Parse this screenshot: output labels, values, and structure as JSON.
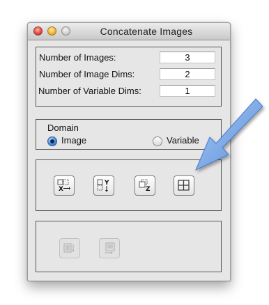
{
  "window": {
    "title": "Concatenate Images"
  },
  "dimensions": {
    "rows": [
      {
        "label": "Number of Images:",
        "value": "3"
      },
      {
        "label": "Number of Image Dims:",
        "value": "2"
      },
      {
        "label": "Number of Variable Dims:",
        "value": "1"
      }
    ]
  },
  "domain": {
    "label": "Domain",
    "options": [
      {
        "label": "Image",
        "selected": true
      },
      {
        "label": "Variable",
        "selected": false
      }
    ]
  },
  "concatenate_buttons": [
    {
      "icon": "concat-x-icon",
      "glyph": "X"
    },
    {
      "icon": "concat-y-icon",
      "glyph": "Y"
    },
    {
      "icon": "concat-z-icon",
      "glyph": "Z"
    },
    {
      "icon": "concat-grid-icon",
      "glyph": ""
    }
  ],
  "variable_buttons": [
    {
      "icon": "variable-concat-vertical-icon",
      "enabled": false
    },
    {
      "icon": "variable-concat-horizontal-icon",
      "enabled": false
    }
  ],
  "colors": {
    "window_bg": "#e6e6e6",
    "arrow": "#6fa2e6",
    "radio_selected": "#4a8ee0"
  }
}
